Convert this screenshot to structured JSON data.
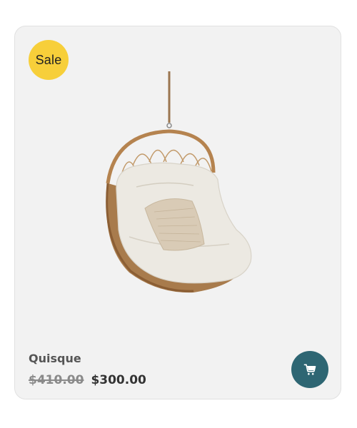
{
  "badge": {
    "label": "Sale"
  },
  "product": {
    "name": "Quisque",
    "price_original": "$410.00",
    "price_sale": "$300.00",
    "image_subject": "hanging-egg-chair"
  },
  "actions": {
    "cart_icon": "cart-icon"
  },
  "colors": {
    "badge_bg": "#f7cf3a",
    "cart_button_bg": "#2e6673",
    "card_bg": "#f2f2f2"
  }
}
